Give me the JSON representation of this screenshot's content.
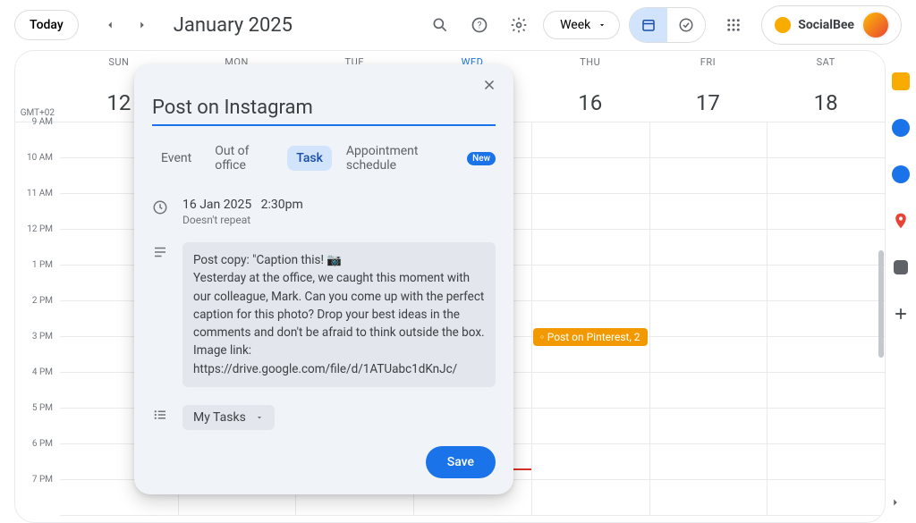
{
  "topbar": {
    "today": "Today",
    "month_title": "January 2025",
    "view_label": "Week",
    "brand": "SocialBee"
  },
  "timezone": "GMT+02",
  "days": [
    {
      "abbr": "SUN",
      "num": "12"
    },
    {
      "abbr": "MON",
      "num": ""
    },
    {
      "abbr": "TUE",
      "num": ""
    },
    {
      "abbr": "WED",
      "num": ""
    },
    {
      "abbr": "THU",
      "num": "16"
    },
    {
      "abbr": "FRI",
      "num": "17"
    },
    {
      "abbr": "SAT",
      "num": "18"
    }
  ],
  "hours": [
    "9 AM",
    "10 AM",
    "11 AM",
    "12 PM",
    "1 PM",
    "2 PM",
    "3 PM",
    "4 PM",
    "5 PM",
    "6 PM",
    "7 PM"
  ],
  "event": {
    "label": "Post on Pinterest, 2"
  },
  "modal": {
    "title": "Post on Instagram",
    "tabs": {
      "event": "Event",
      "ooo": "Out of office",
      "task": "Task",
      "appt": "Appointment schedule",
      "new": "New"
    },
    "date": "16 Jan 2025",
    "time": "2:30pm",
    "repeat": "Doesn't repeat",
    "desc_line1": "Post copy: \"Caption this! 📷",
    "desc_line2": "Yesterday at the office, we caught this moment with our colleague, Mark. Can you come up with the perfect caption for this photo? Drop your best ideas in the comments and don't be afraid to think outside the box.",
    "desc_line3": "Image link: https://drive.google.com/file/d/1ATUabc1dKnJc/",
    "list": "My Tasks",
    "save": "Save"
  }
}
